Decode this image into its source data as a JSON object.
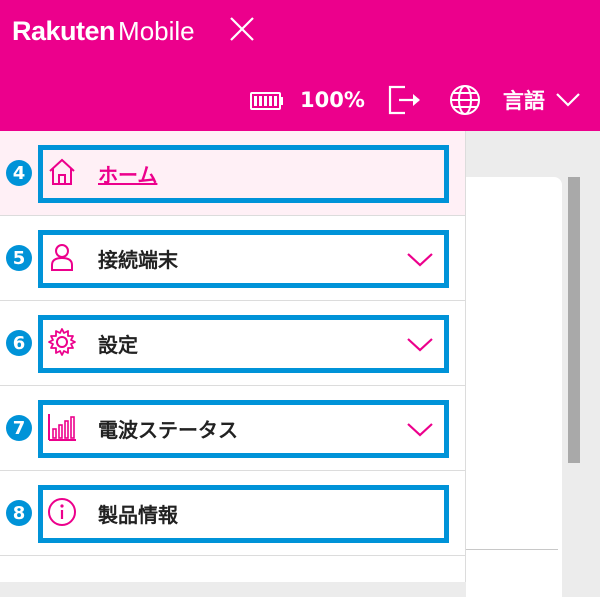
{
  "header": {
    "logo_part1": "Rakuten",
    "logo_part2": "Mobile",
    "battery_percent": "100%",
    "language_label": "言語",
    "brand_color": "#ec008c"
  },
  "menu": {
    "items": [
      {
        "step": "4",
        "label": "ホーム",
        "icon": "home-icon",
        "active": true,
        "expandable": false
      },
      {
        "step": "5",
        "label": "接続端末",
        "icon": "person-icon",
        "active": false,
        "expandable": true
      },
      {
        "step": "6",
        "label": "設定",
        "icon": "gear-icon",
        "active": false,
        "expandable": true
      },
      {
        "step": "7",
        "label": "電波ステータス",
        "icon": "signal-bars-icon",
        "active": false,
        "expandable": true
      },
      {
        "step": "8",
        "label": "製品情報",
        "icon": "info-icon",
        "active": false,
        "expandable": false
      }
    ],
    "highlight_color": "#0093d8"
  }
}
